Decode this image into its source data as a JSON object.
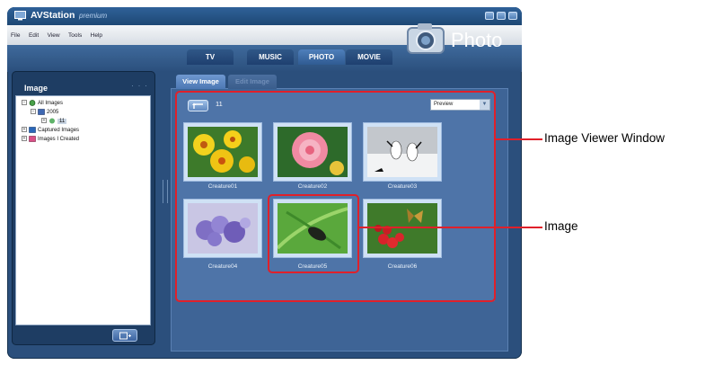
{
  "window": {
    "title": "AVStation",
    "title_suffix": "premium"
  },
  "menu": [
    "File",
    "Edit",
    "View",
    "Tools",
    "Help"
  ],
  "mode_tabs": [
    {
      "label": "TV"
    },
    {
      "label": "MUSIC"
    },
    {
      "label": "PHOTO"
    },
    {
      "label": "MOVIE"
    }
  ],
  "brand": {
    "label": "Photo",
    "icon": "camera-icon"
  },
  "side_panel": {
    "title": "Image",
    "tree": [
      {
        "label": "All Images",
        "icon": "all-images-icon",
        "expander": "−"
      },
      {
        "label": "2005",
        "icon": "calendar-icon",
        "expander": "−"
      },
      {
        "label": "11",
        "icon": "month-icon",
        "expander": "+"
      },
      {
        "label": "Captured Images",
        "icon": "captured-images-icon",
        "expander": "+"
      },
      {
        "label": "Images I Created",
        "icon": "created-images-icon",
        "expander": "+"
      }
    ],
    "add_button_icon": "add-folder-icon"
  },
  "content_tabs": [
    {
      "label": "View Image",
      "active": true
    },
    {
      "label": "Edit Image",
      "active": false
    }
  ],
  "viewer": {
    "folder_count": "11",
    "view_select": "Preview",
    "thumbnails": [
      {
        "label": "Creature01",
        "subject": "yellow flowers"
      },
      {
        "label": "Creature02",
        "subject": "pink flower"
      },
      {
        "label": "Creature03",
        "subject": "cranes in snow"
      },
      {
        "label": "Creature04",
        "subject": "purple flowers"
      },
      {
        "label": "Creature05",
        "subject": "beetle on leaf"
      },
      {
        "label": "Creature06",
        "subject": "butterfly on red berries"
      }
    ]
  },
  "callouts": {
    "viewer_window": "Image Viewer Window",
    "image": "Image"
  },
  "colors": {
    "callout_red": "#e0202a",
    "frame_blue": "#2b4f7c",
    "viewer_blue": "#4e74a8"
  }
}
